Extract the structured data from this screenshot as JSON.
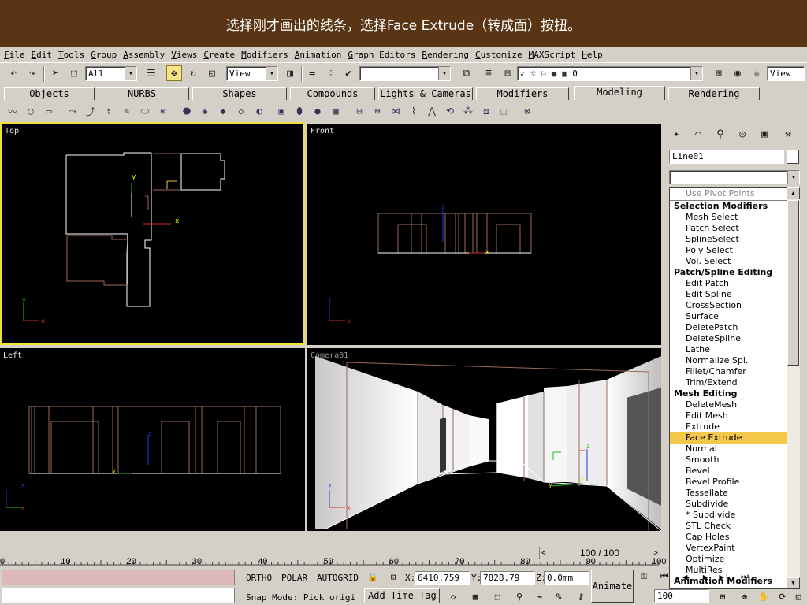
{
  "banner": {
    "text": "选择刚才画出的线条，选择Face Extrude（转成面）按扭。"
  },
  "menu": [
    "File",
    "Edit",
    "Tools",
    "Group",
    "Assembly",
    "Views",
    "Create",
    "Modifiers",
    "Animation",
    "Graph Editors",
    "Rendering",
    "Customize",
    "MAXScript",
    "Help"
  ],
  "toolbar": {
    "selection_filter": "All",
    "ref_coord": "View",
    "named_selection": "",
    "layer": "0",
    "render_type": "View"
  },
  "tabs": [
    "Objects",
    "NURBS",
    "Shapes",
    "Compounds",
    "Lights & Cameras",
    "Modifiers",
    "Modeling",
    "Rendering"
  ],
  "active_tab": "Modeling",
  "viewports": {
    "top": "Top",
    "front": "Front",
    "left": "Left",
    "camera": "Camera01"
  },
  "command_panel": {
    "object_name": "Line01",
    "modifier_list_value": "",
    "object_color": "#ffffff",
    "list": [
      {
        "label": "Use Pivot Points",
        "kind": "dim"
      },
      {
        "label": "Selection Modifiers",
        "kind": "header"
      },
      {
        "label": "Mesh Select",
        "kind": "item"
      },
      {
        "label": "Patch Select",
        "kind": "item"
      },
      {
        "label": "SplineSelect",
        "kind": "item"
      },
      {
        "label": "Poly Select",
        "kind": "item"
      },
      {
        "label": "Vol. Select",
        "kind": "item"
      },
      {
        "label": "Patch/Spline Editing",
        "kind": "header"
      },
      {
        "label": "Edit Patch",
        "kind": "item"
      },
      {
        "label": "Edit Spline",
        "kind": "item"
      },
      {
        "label": "CrossSection",
        "kind": "item"
      },
      {
        "label": "Surface",
        "kind": "item"
      },
      {
        "label": "DeletePatch",
        "kind": "item"
      },
      {
        "label": "DeleteSpline",
        "kind": "item"
      },
      {
        "label": "Lathe",
        "kind": "item"
      },
      {
        "label": "Normalize Spl.",
        "kind": "item"
      },
      {
        "label": "Fillet/Chamfer",
        "kind": "item"
      },
      {
        "label": "Trim/Extend",
        "kind": "item"
      },
      {
        "label": "Mesh Editing",
        "kind": "header"
      },
      {
        "label": "DeleteMesh",
        "kind": "item"
      },
      {
        "label": "Edit Mesh",
        "kind": "item"
      },
      {
        "label": "Extrude",
        "kind": "item"
      },
      {
        "label": "Face Extrude",
        "kind": "selected"
      },
      {
        "label": "Normal",
        "kind": "item"
      },
      {
        "label": "Smooth",
        "kind": "item"
      },
      {
        "label": "Bevel",
        "kind": "item"
      },
      {
        "label": "Bevel Profile",
        "kind": "item"
      },
      {
        "label": "Tessellate",
        "kind": "item"
      },
      {
        "label": "Subdivide",
        "kind": "item"
      },
      {
        "label": "* Subdivide",
        "kind": "item"
      },
      {
        "label": "STL Check",
        "kind": "item"
      },
      {
        "label": "Cap Holes",
        "kind": "item"
      },
      {
        "label": "VertexPaint",
        "kind": "item"
      },
      {
        "label": "Optimize",
        "kind": "item"
      },
      {
        "label": "MultiRes",
        "kind": "item"
      },
      {
        "label": "Animation Modifiers",
        "kind": "header"
      }
    ]
  },
  "timeline": {
    "frame_display": "100 / 100",
    "ticks": [
      "0",
      "10",
      "20",
      "30",
      "40",
      "50",
      "60",
      "70",
      "80",
      "90",
      "100"
    ]
  },
  "status": {
    "ortho": "ORTHO",
    "polar": "POLAR",
    "autogrid": "AUTOGRID",
    "x_label": "X:",
    "x_value": "6410.759",
    "y_label": "Y:",
    "y_value": "7828.79",
    "z_label": "Z:",
    "z_value": "0.0mm",
    "prompt": "Snap Mode: Pick origi",
    "add_time_tag": "Add Time Tag",
    "animate": "Animate",
    "frame_field": "100"
  },
  "colors": {
    "banner_bg": "#5a3515",
    "active_viewport_border": "#f0e040",
    "selected_item_bg": "#f3c74a",
    "wire_white": "#ffffff",
    "wire_brown": "#9a6a5a"
  }
}
